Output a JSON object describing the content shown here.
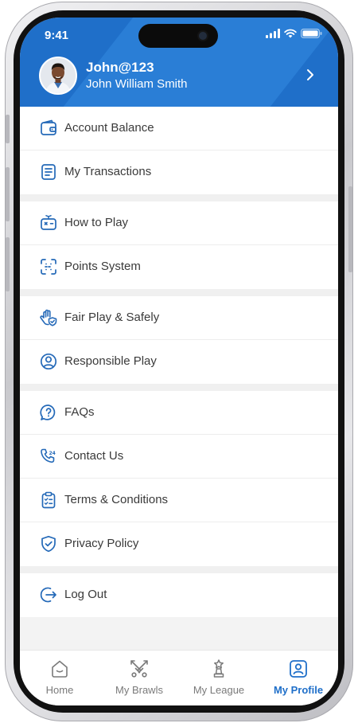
{
  "status_bar": {
    "time": "9:41"
  },
  "profile": {
    "username": "John@123",
    "full_name": "John William Smith"
  },
  "menu_groups": [
    [
      {
        "label": "Account Balance",
        "icon": "wallet-icon"
      },
      {
        "label": "My Transactions",
        "icon": "transactions-icon"
      }
    ],
    [
      {
        "label": "How to Play",
        "icon": "gamepad-icon"
      },
      {
        "label": "Points System",
        "icon": "points-scan-icon"
      }
    ],
    [
      {
        "label": "Fair Play & Safely",
        "icon": "hand-shield-icon"
      },
      {
        "label": "Responsible Play",
        "icon": "user-circle-icon"
      }
    ],
    [
      {
        "label": "FAQs",
        "icon": "question-chat-icon"
      },
      {
        "label": "Contact Us",
        "icon": "phone-24-icon"
      },
      {
        "label": "Terms & Conditions",
        "icon": "clipboard-check-icon"
      },
      {
        "label": "Privacy Policy",
        "icon": "shield-check-icon"
      }
    ],
    [
      {
        "label": "Log Out",
        "icon": "logout-icon"
      }
    ]
  ],
  "tabs": [
    {
      "label": "Home",
      "icon": "home-icon",
      "active": false
    },
    {
      "label": "My Brawls",
      "icon": "crossed-swords-icon",
      "active": false
    },
    {
      "label": "My League",
      "icon": "trophy-icon",
      "active": false
    },
    {
      "label": "My Profile",
      "icon": "profile-badge-icon",
      "active": true
    }
  ],
  "colors": {
    "accent": "#1f6fc9",
    "icon_blue": "#2469b8",
    "tab_gray": "#7a7a7a"
  }
}
